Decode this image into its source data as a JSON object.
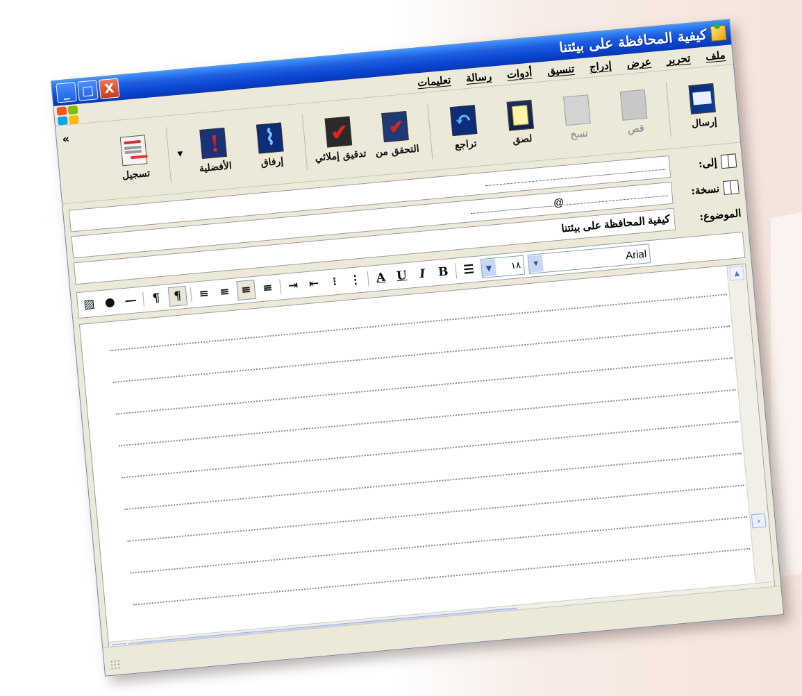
{
  "window": {
    "title": "كيفية المحافظة على بيئتنا",
    "controls": {
      "minimize": "_",
      "maximize": "□",
      "close": "X"
    }
  },
  "menu": {
    "items": [
      "ملف",
      "تحرير",
      "عرض",
      "إدراج",
      "تنسيق",
      "أدوات",
      "رسالة",
      "تعليمات"
    ]
  },
  "toolbar": {
    "buttons": [
      {
        "label": "إرسال",
        "icon": "send-icon",
        "enabled": true
      },
      {
        "label": "قص",
        "icon": "cut-icon",
        "enabled": false
      },
      {
        "label": "نسخ",
        "icon": "copy-icon",
        "enabled": false
      },
      {
        "label": "لصق",
        "icon": "paste-icon",
        "enabled": true
      },
      {
        "label": "تراجع",
        "icon": "undo-icon",
        "enabled": true
      },
      {
        "label": "التحقق من",
        "icon": "check-names-icon",
        "enabled": true
      },
      {
        "label": "تدقيق إملائي",
        "icon": "spelling-icon",
        "enabled": true
      },
      {
        "label": "إرفاق",
        "icon": "attach-icon",
        "enabled": true
      },
      {
        "label": "الأفضلية",
        "icon": "priority-icon",
        "enabled": true
      },
      {
        "label": "تسجيل",
        "icon": "sign-icon",
        "enabled": true
      }
    ],
    "more": "»"
  },
  "headers": {
    "to_label": "إلى:",
    "cc_label": "نسخة:",
    "subject_label": "الموضوع:",
    "to_value": "",
    "cc_value": "@",
    "subject_value": "كيفية المحافظة على بيئتنا"
  },
  "format": {
    "font": "Arial",
    "size": "١٨",
    "bold": "B",
    "italic": "I",
    "underline": "U",
    "font_color": "A"
  },
  "colors": {
    "title_bar": "#0a46d4",
    "window_bg": "#ece9d8",
    "close_button": "#c73b16"
  }
}
